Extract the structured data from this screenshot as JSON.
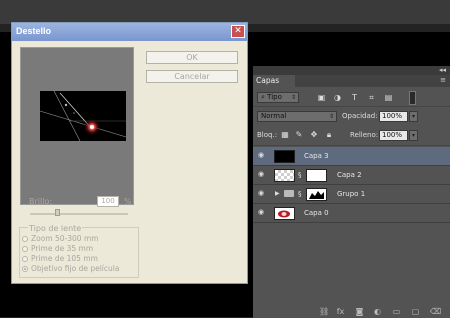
{
  "dialog": {
    "title": "Destello",
    "ok_label": "OK",
    "cancel_label": "Cancelar",
    "brightness_label": "Brillo:",
    "brightness_value": "100",
    "brightness_unit": "%",
    "lens_group_label": "Tipo de lente",
    "lens_options": [
      {
        "label": "Zoom 50-300 mm",
        "checked": false
      },
      {
        "label": "Prime de 35 mm",
        "checked": false
      },
      {
        "label": "Prime de 105 mm",
        "checked": false
      },
      {
        "label": "Objetivo fijo de película",
        "checked": true
      }
    ]
  },
  "layers_panel": {
    "tab_label": "Capas",
    "filter_label": "Tipo",
    "blend_mode": "Normal",
    "opacity_label": "Opacidad:",
    "opacity_value": "100%",
    "lock_label": "Bloq.:",
    "fill_label": "Relleno:",
    "fill_value": "100%",
    "layers": [
      {
        "name": "Capa 3",
        "selected": true,
        "thumb_color": "#000000"
      },
      {
        "name": "Capa 2",
        "selected": false,
        "thumb_color": "#ffffff"
      },
      {
        "name": "Grupo 1",
        "selected": false,
        "thumb_color": "#ffffff"
      },
      {
        "name": "Capa 0",
        "selected": false,
        "thumb_color": "#ffffff"
      }
    ]
  },
  "colors": {
    "panel_bg": "#535353",
    "selected_layer": "#5e6b7e",
    "dialog_bg": "#ece9d8",
    "titlebar": "#7a96cf"
  }
}
